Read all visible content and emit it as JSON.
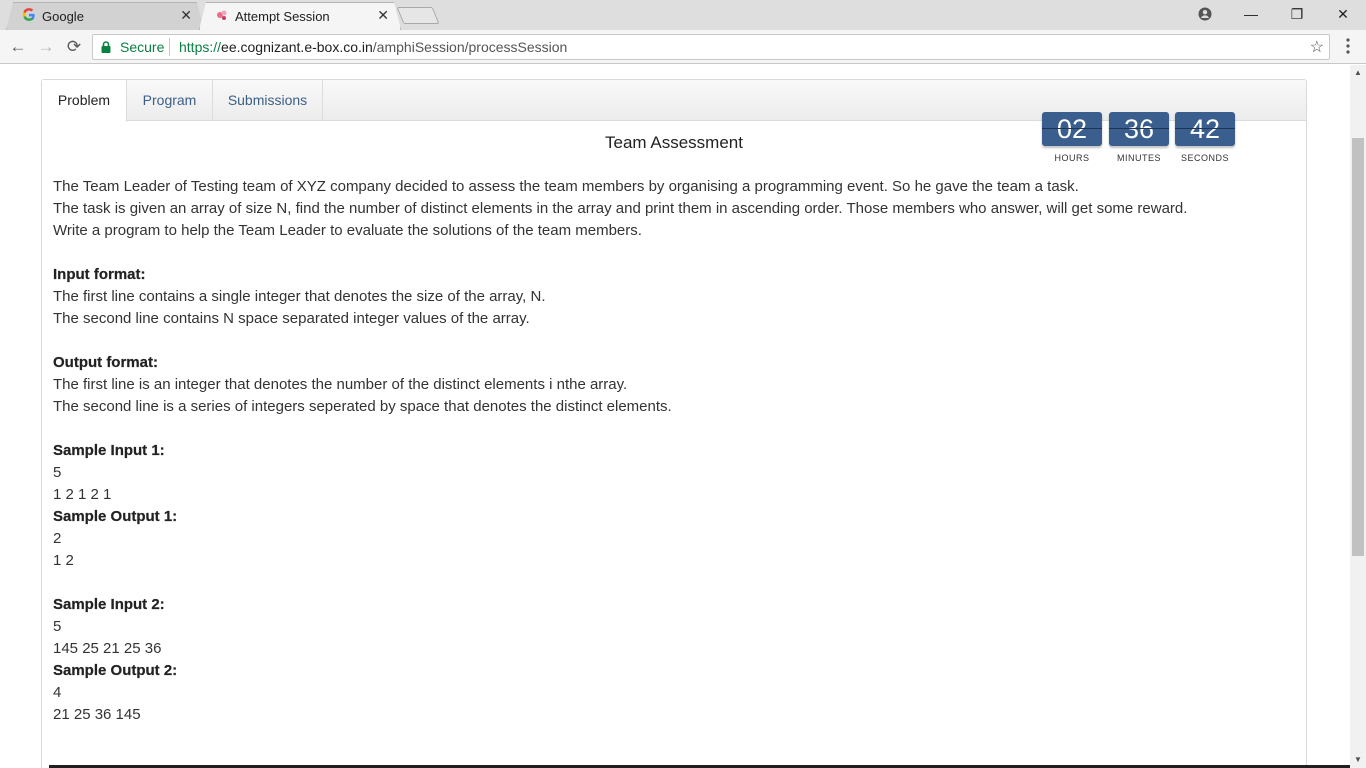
{
  "browser": {
    "tabs": [
      {
        "title": "Google",
        "close": "✕"
      },
      {
        "title": "Attempt Session",
        "close": "✕"
      }
    ],
    "window_controls": {
      "account": "●",
      "minimize": "—",
      "restore": "❐",
      "close": "✕"
    },
    "nav": {
      "back": "←",
      "forward": "→",
      "reload": "⟳"
    },
    "address": {
      "security_label": "Secure",
      "scheme": "https://",
      "domain": "ee.cognizant.e-box.co.in",
      "path": "/amphiSession/processSession"
    },
    "star": "☆",
    "menu": "⋮"
  },
  "page": {
    "tabs": {
      "problem": "Problem",
      "program": "Program",
      "submissions": "Submissions"
    },
    "title": "Team Assessment",
    "timer": {
      "hours": "02",
      "minutes": "36",
      "seconds": "42",
      "hours_label": "HOURS",
      "minutes_label": "MINUTES",
      "seconds_label": "SECONDS",
      "box_color": "#3a5f8e"
    },
    "problem": {
      "intro": [
        "The Team Leader of Testing team of XYZ company decided to assess the team members by organising a programming event. So he gave the team a task.",
        "The task is given an array of size N, find the number of distinct elements in the array and print them in ascending order. Those members who answer, will get some reward.",
        "Write a program to help the Team Leader to evaluate the solutions of the team members."
      ],
      "input_heading": "Input format:",
      "input_lines": [
        "The first line contains a single integer that denotes the size of the array, N.",
        "The second line contains N space separated integer values of the array."
      ],
      "output_heading": "Output format:",
      "output_lines": [
        "The first line is an integer that denotes the number of the distinct elements i nthe array.",
        "The second line is a series of integers seperated by space that denotes the distinct elements."
      ],
      "sample_input_1_heading": "Sample Input 1:",
      "sample_input_1": [
        "5",
        "1 2 1 2 1"
      ],
      "sample_output_1_heading": "Sample Output 1:",
      "sample_output_1": [
        "2",
        "1 2"
      ],
      "sample_input_2_heading": "Sample Input 2:",
      "sample_input_2": [
        "5",
        "145 25 21 25 36"
      ],
      "sample_output_2_heading": "Sample Output 2:",
      "sample_output_2": [
        "4",
        "21 25 36 145"
      ]
    }
  }
}
